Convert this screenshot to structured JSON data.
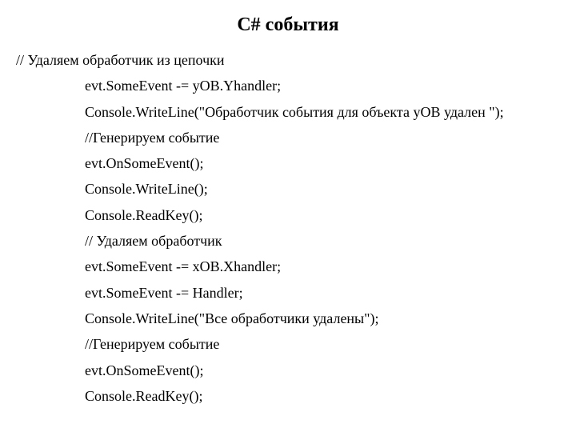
{
  "title": "C#    события",
  "lines": [
    {
      "kind": "comment",
      "text": "// Удаляем обработчик из цепочки"
    },
    {
      "kind": "code",
      "text": "evt.SomeEvent -= yOB.Yhandler;"
    },
    {
      "kind": "code",
      "text": "Console.WriteLine(\"Обработчик события для объекта yOB удален \");"
    },
    {
      "kind": "code",
      "text": "//Генерируем событие"
    },
    {
      "kind": "code",
      "text": "evt.OnSomeEvent();"
    },
    {
      "kind": "code",
      "text": "Console.WriteLine();"
    },
    {
      "kind": "code",
      "text": "Console.ReadKey();"
    },
    {
      "kind": "code",
      "text": "// Удаляем обработчик"
    },
    {
      "kind": "code",
      "text": "evt.SomeEvent -= xOB.Xhandler;"
    },
    {
      "kind": "code",
      "text": "evt.SomeEvent -= Handler;"
    },
    {
      "kind": "code",
      "text": "Console.WriteLine(\"Все обработчики удалены\");"
    },
    {
      "kind": "code",
      "text": "//Генерируем событие"
    },
    {
      "kind": "code",
      "text": "evt.OnSomeEvent();"
    },
    {
      "kind": "code",
      "text": "Console.ReadKey();"
    }
  ]
}
